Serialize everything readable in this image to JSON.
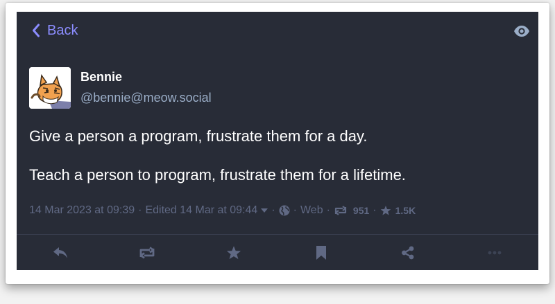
{
  "nav": {
    "back_label": "Back"
  },
  "status": {
    "author": {
      "display_name": "Bennie",
      "handle": "@bennie@meow.social"
    },
    "content": [
      "Give a person a program, frustrate them for a day.",
      "Teach a person to program, frustrate them for a lifetime."
    ],
    "meta": {
      "timestamp": "14 Mar 2023 at 09:39",
      "edited": "Edited 14 Mar at 09:44",
      "separator": "·",
      "application": "Web",
      "reblogs": "951",
      "favourites": "1.5K"
    }
  },
  "actions": [
    "reply-icon",
    "boost-icon",
    "favourite-icon",
    "bookmark-icon",
    "share-icon",
    "more-icon"
  ],
  "colors": {
    "background": "#282c37",
    "accent": "#8c8dff",
    "secondary_text": "#9baec8",
    "meta_text": "#606984",
    "action_icon": "#606984"
  }
}
